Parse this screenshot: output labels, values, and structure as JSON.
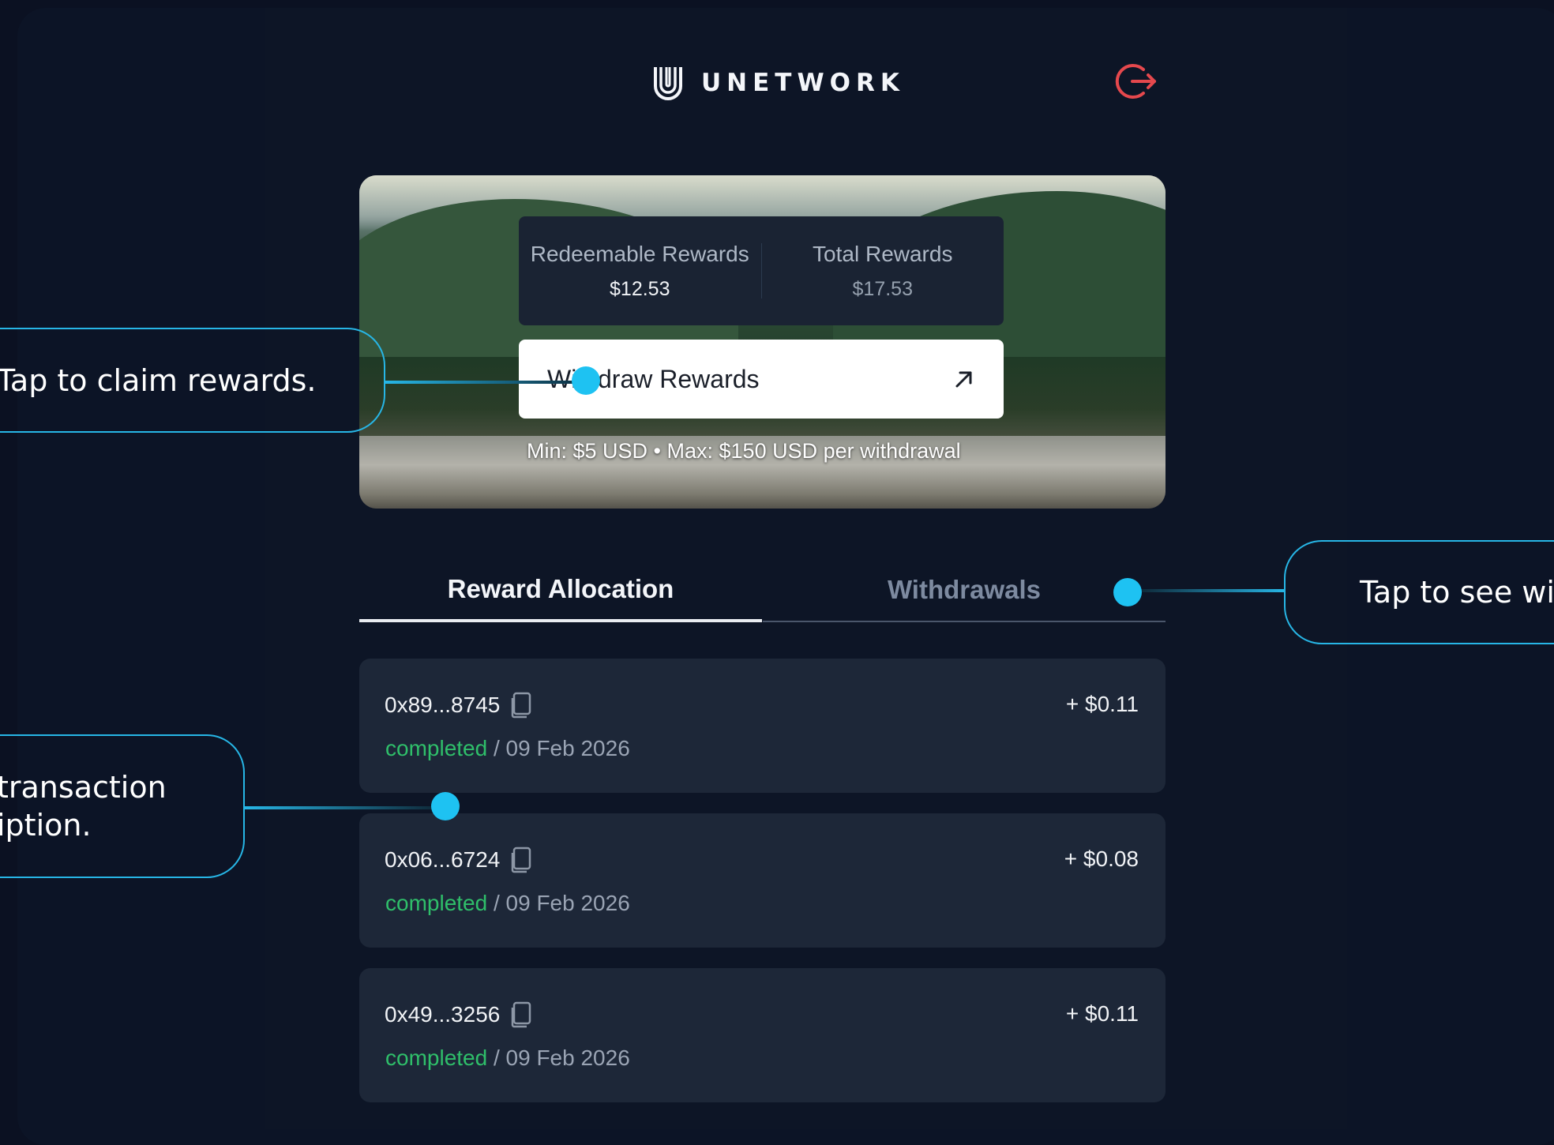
{
  "brand": {
    "name": "UNETWORK"
  },
  "header": {
    "logout_icon": "logout-icon"
  },
  "rewards": {
    "redeemable_label": "Redeemable Rewards",
    "redeemable_value": "$12.53",
    "total_label": "Total Rewards",
    "total_value": "$17.53",
    "withdraw_button": "Withdraw Rewards",
    "limits": "Min: $5 USD • Max: $150 USD per withdrawal"
  },
  "tabs": [
    {
      "label": "Reward Allocation",
      "active": true
    },
    {
      "label": "Withdrawals",
      "active": false
    }
  ],
  "transactions": [
    {
      "hash": "0x89...8745",
      "status": "completed",
      "date": " / 09 Feb 2026",
      "amount": "+ $0.11"
    },
    {
      "hash": "0x06...6724",
      "status": "completed",
      "date": " / 09 Feb 2026",
      "amount": "+ $0.08"
    },
    {
      "hash": "0x49...3256",
      "status": "completed",
      "date": " / 09 Feb 2026",
      "amount": "+ $0.11"
    }
  ],
  "callouts": {
    "claim": "Tap to claim rewards.",
    "transaction": "transaction\niption.",
    "withdrawals": "Tap to see wi"
  },
  "colors": {
    "accent": "#1ec2f2",
    "status_completed": "#2fbf6a",
    "logout": "#e5484d",
    "background": "#0c1426"
  }
}
